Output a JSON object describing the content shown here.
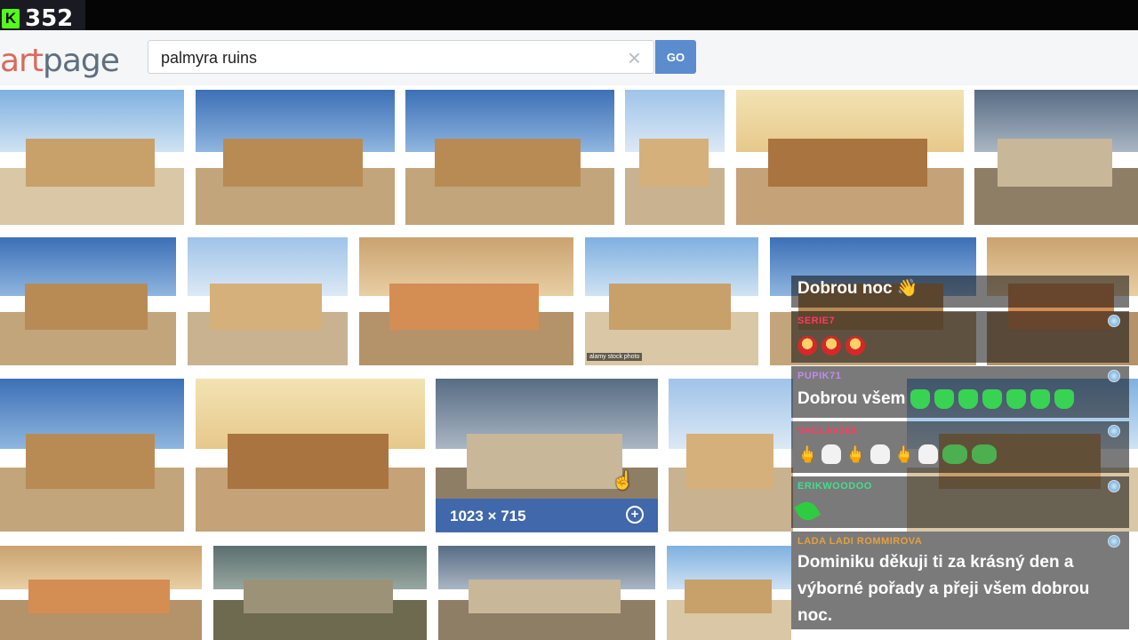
{
  "overlay": {
    "viewer_count": "352",
    "platform_letter": "K"
  },
  "search": {
    "logo_prefix": "art",
    "logo_suffix": "page",
    "query": "palmyra ruins",
    "clear_glyph": "×",
    "go_label": "GO"
  },
  "grid": {
    "hover_dimensions": "1023 × 715",
    "hover_add_glyph": "+",
    "stock_watermark": "alamy stock photo"
  },
  "chat": [
    {
      "user": "",
      "text": "Dobrou noc 👋"
    },
    {
      "user": "SERIE7",
      "text": ""
    },
    {
      "user": "PUPIK71",
      "text": "Dobrou všem"
    },
    {
      "user": "VACLAV369",
      "text": ""
    },
    {
      "user": "ERIKWOODOO",
      "text": ""
    },
    {
      "user": "LADA LADI ROMMIROVA",
      "text": "Dominiku děkuji ti za krásný den a výborné pořady a přeji všem dobrou noc."
    }
  ],
  "colors": {
    "kick_green": "#53fc18",
    "go_blue": "#5b8ccd",
    "hover_blue": "#3a66b0"
  }
}
